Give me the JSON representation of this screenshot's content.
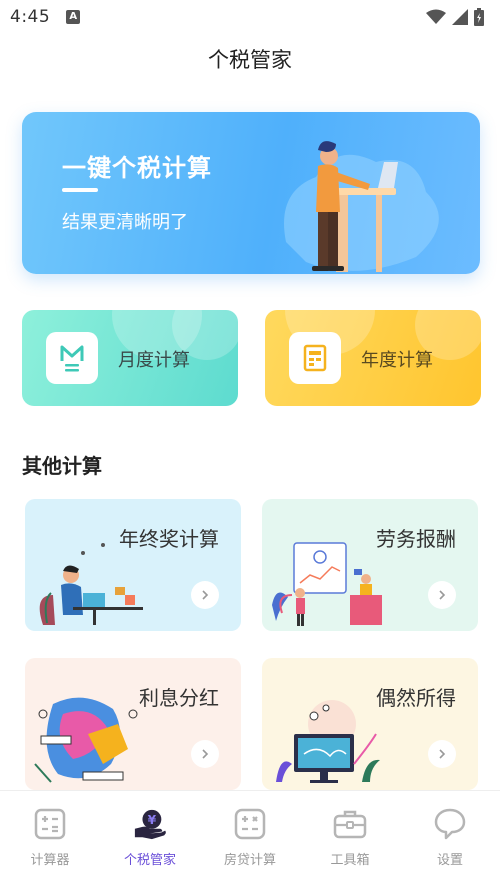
{
  "status_bar": {
    "time": "4:45",
    "notification_icon": "text-a-icon",
    "signal_icons": [
      "wifi-icon",
      "cell-signal-icon",
      "battery-icon"
    ]
  },
  "header": {
    "title": "个税管家"
  },
  "banner": {
    "title": "一键个税计算",
    "subtitle": "结果更清晰明了",
    "illustration": "person-at-standing-desk"
  },
  "quick_cards": [
    {
      "label": "月度计算",
      "icon": "monthly-m-icon",
      "color": "#5ddbcf"
    },
    {
      "label": "年度计算",
      "icon": "yearly-calendar-icon",
      "color": "#ffc52e"
    }
  ],
  "other": {
    "title": "其他计算",
    "items": [
      {
        "label": "年终奖计算",
        "illustration": "person-at-laptop",
        "bg": "#d9f2fb"
      },
      {
        "label": "劳务报酬",
        "illustration": "people-with-screen-charts",
        "bg": "#e4f7f0"
      },
      {
        "label": "利息分红",
        "illustration": "abstract-geometric",
        "bg": "#fdf0ea"
      },
      {
        "label": "偶然所得",
        "illustration": "monitor-with-plants",
        "bg": "#fdf6e2"
      }
    ]
  },
  "bottom_nav": {
    "active_index": 1,
    "items": [
      {
        "label": "计算器",
        "icon": "calculator-icon"
      },
      {
        "label": "个税管家",
        "icon": "tax-yen-hand-icon"
      },
      {
        "label": "房贷计算",
        "icon": "mortgage-calculator-icon"
      },
      {
        "label": "工具箱",
        "icon": "toolbox-icon"
      },
      {
        "label": "设置",
        "icon": "settings-chat-icon"
      }
    ]
  }
}
